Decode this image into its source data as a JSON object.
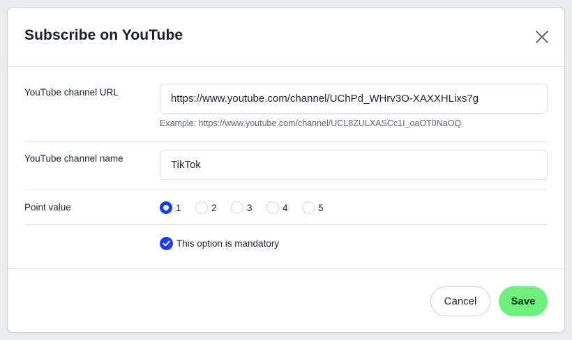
{
  "dialog": {
    "title": "Subscribe on YouTube",
    "close_icon": "close-icon"
  },
  "fields": {
    "channel_url": {
      "label": "YouTube channel URL",
      "value": "https://www.youtube.com/channel/UChPd_WHrv3O-XAXXHLixs7g",
      "hint": "Example: https://www.youtube.com/channel/UCL8ZULXASCc1I_oaOT0NaOQ"
    },
    "channel_name": {
      "label": "YouTube channel name",
      "value": "TikTok"
    },
    "point_value": {
      "label": "Point value",
      "options": [
        "1",
        "2",
        "3",
        "4",
        "5"
      ],
      "selected": "1"
    },
    "mandatory": {
      "label": "This option is mandatory",
      "checked": true
    }
  },
  "footer": {
    "cancel_label": "Cancel",
    "save_label": "Save"
  },
  "colors": {
    "accent": "#1a3cff",
    "save_button": "#6ef07e"
  }
}
